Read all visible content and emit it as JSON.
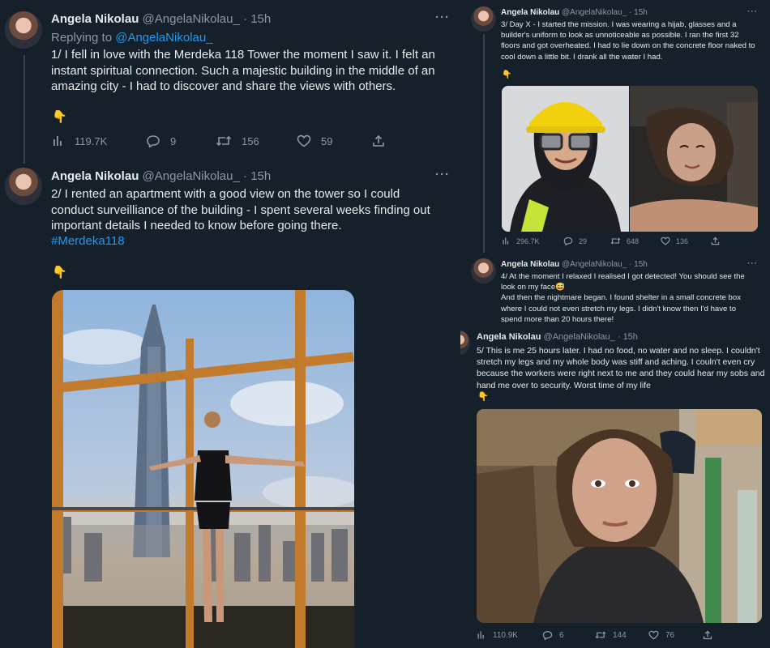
{
  "tweets": [
    {
      "name": "Angela Nikolau",
      "handle": "@AngelaNikolau_",
      "dot": "·",
      "time": "15h",
      "replying_label": "Replying to",
      "replying_handle": "@AngelaNikolau_",
      "text": "1/ I fell in love with the Merdeka 118 Tower the moment I saw it. I felt an instant spiritual connection. Such a majestic building in the middle of an amazing city - I had to discover and share the views with others.",
      "emoji": "👇",
      "views": "119.7K",
      "replies": "9",
      "retweets": "156",
      "likes": "59",
      "more": "···"
    },
    {
      "name": "Angela Nikolau",
      "handle": "@AngelaNikolau_",
      "dot": "·",
      "time": "15h",
      "text": "2/ I rented an apartment with a good view on the tower so I could conduct surveilliance of the building - I spent several weeks finding out important details I needed to know before going there.",
      "hashtag": "#Merdeka118",
      "emoji": "👇",
      "more": "···"
    },
    {
      "name": "Angela Nikolau",
      "handle": "@AngelaNikolau_",
      "dot": "·",
      "time": "15h",
      "text": "3/ Day X - I started the mission. I was wearing a hijab, glasses and a builder's uniform to look as unnoticeable as possible. I ran the first 32 floors and got overheated. I had to lie down on the concrete floor naked to cool down a little bit. I drank all the water I had.",
      "emoji": "👇",
      "views": "296.7K",
      "replies": "29",
      "retweets": "648",
      "likes": "136",
      "more": "···"
    },
    {
      "name": "Angela Nikolau",
      "handle": "@AngelaNikolau_",
      "dot": "·",
      "time": "15h",
      "text_a": "4/ At the moment I relaxed I realised I got detected! You should see the look on my face",
      "text_emoji": "😅",
      "text_b": "And then the nightmare began. I found shelter in a small concrete box where I could not even stretch my legs. I didn't know then I'd have to spend more than 20 hours there!",
      "more": "···"
    },
    {
      "name": "Angela Nikolau",
      "handle": "@AngelaNikolau_",
      "dot": "·",
      "time": "15h",
      "text": "5/ This is me 25 hours later. I had no food, no water and no sleep. I couldn't stretch my legs and my whole body was stiff and aching. I couln't even cry because the workers were right next to me and they could hear my sobs and hand me over to security. Worst time of my life",
      "emoji": "👇",
      "views": "110.9K",
      "replies": "6",
      "retweets": "144",
      "likes": "76",
      "more": "···"
    }
  ],
  "colors": {
    "background": "#15202b",
    "text": "#e7e9ea",
    "secondary": "#8b98a5",
    "link": "#1d9bf0",
    "divider": "#38444d"
  }
}
